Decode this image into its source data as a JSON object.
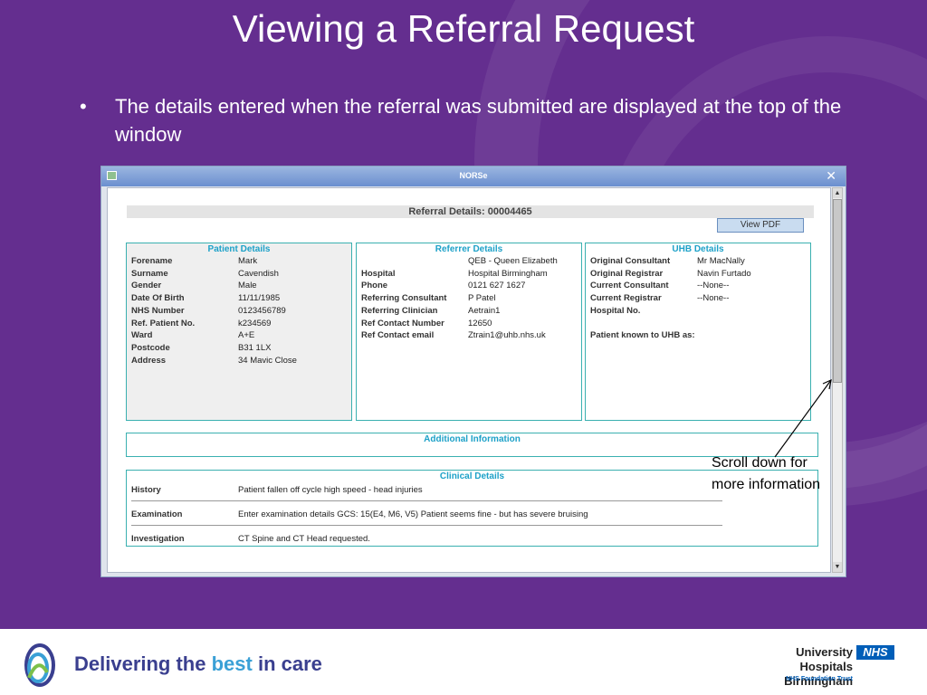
{
  "slide": {
    "title": "Viewing a Referral Request",
    "bullet_marker": "•",
    "bullet": "The details entered when the referral was submitted are displayed at the top of the window"
  },
  "window": {
    "title": "NORSe",
    "close_glyph": "✕",
    "icon": "window-app-icon",
    "scroll_up_glyph": "▲",
    "scroll_down_glyph": "▼",
    "referral_header": "Referral Details: 00004465",
    "view_pdf_label": "View PDF",
    "patient": {
      "title": "Patient Details",
      "rows": [
        {
          "label": "Forename",
          "value": "Mark"
        },
        {
          "label": "Surname",
          "value": "Cavendish"
        },
        {
          "label": "Gender",
          "value": "Male"
        },
        {
          "label": "Date Of Birth",
          "value": "11/11/1985"
        },
        {
          "label": "NHS Number",
          "value": "0123456789"
        },
        {
          "label": "Ref. Patient No.",
          "value": "k234569"
        },
        {
          "label": "Ward",
          "value": "A+E"
        },
        {
          "label": "Postcode",
          "value": "B31 1LX"
        },
        {
          "label": "Address",
          "value": "34 Mavic Close"
        }
      ]
    },
    "referrer": {
      "title": "Referrer Details",
      "hospital_line1": "QEB - Queen Elizabeth",
      "rows": [
        {
          "label": "Hospital",
          "value": "Hospital Birmingham"
        },
        {
          "label": "Phone",
          "value": "0121 627 1627"
        },
        {
          "label": "Referring Consultant",
          "value": "P Patel"
        },
        {
          "label": "Referring Clinician",
          "value": "Aetrain1"
        },
        {
          "label": "Ref Contact Number",
          "value": "12650"
        },
        {
          "label": "Ref Contact email",
          "value": "Ztrain1@uhb.nhs.uk"
        }
      ]
    },
    "uhb": {
      "title": "UHB Details",
      "rows": [
        {
          "label": "Original Consultant",
          "value": "Mr MacNally"
        },
        {
          "label": "Original Registrar",
          "value": "Navin Furtado"
        },
        {
          "label": "Current Consultant",
          "value": "--None--"
        },
        {
          "label": "Current Registrar",
          "value": "--None--"
        },
        {
          "label": "Hospital No.",
          "value": ""
        }
      ],
      "known_as_label": "Patient known to UHB as:"
    },
    "additional": {
      "title": "Additional Information"
    },
    "clinical": {
      "title": "Clinical Details",
      "rows": [
        {
          "label": "History",
          "value": "Patient fallen off cycle high speed - head injuries"
        },
        {
          "label": "Examination",
          "value": "Enter examination details GCS: 15(E4, M6, V5) Patient seems fine - but has severe bruising"
        },
        {
          "label": "Investigation",
          "value": "CT Spine and CT Head requested."
        }
      ]
    }
  },
  "annotation": {
    "line1": "Scroll down for",
    "line2": "more information"
  },
  "footer": {
    "tagline_part1": "Delivering the ",
    "tagline_best": "best",
    "tagline_part2": " in care",
    "org_line1": "University Hospitals",
    "org_line2": "Birmingham",
    "nhs_badge": "NHS",
    "org_trust": "NHS Foundation Trust",
    "logo_icon": "uhb-swirl-logo-icon"
  },
  "colors": {
    "slide_bg": "#642e8f",
    "panel_title": "#1da1c8",
    "panel_border": "#3ab0b0",
    "tagline_dark": "#3a3f8f",
    "tagline_best": "#3aa0d6",
    "nhs_blue": "#005eb8"
  }
}
